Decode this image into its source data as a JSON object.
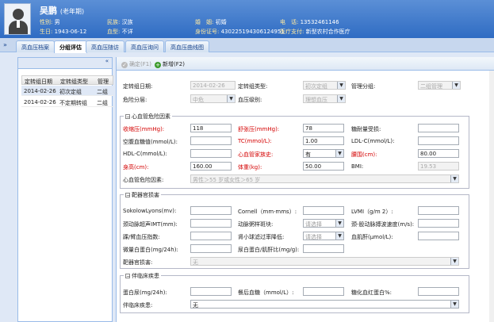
{
  "header": {
    "name": "吴鹏",
    "tag": "(老年期)",
    "gender_label": "性别:",
    "gender": "男",
    "ethnicity_label": "民族:",
    "ethnicity": "汉族",
    "marital_label": "婚　姻:",
    "marital": "初婚",
    "phone_label": "电　话:",
    "phone": "13532461146",
    "birth_label": "生日:",
    "birth": "1943-06-12",
    "blood_label": "血型:",
    "blood": "不详",
    "id_label": "身份证号:",
    "id": "430225194306124951",
    "insurance_label": "医疗支付:",
    "insurance": "新型农村合作医疗"
  },
  "tabs": [
    "高血压档案",
    "分组评估",
    "高血压随访",
    "高血压询问",
    "高血压曲线图"
  ],
  "active_tab": 1,
  "left_panel": {
    "collapse": "«",
    "columns": [
      "定转组日期",
      "定转组类型",
      "管理"
    ],
    "rows": [
      {
        "date": "2014-02-26",
        "type": "初次定组",
        "level": "二组"
      },
      {
        "date": "2014-02-26",
        "type": "不定期转组",
        "level": "二组"
      }
    ]
  },
  "toolbar": {
    "confirm": "确定(F1)",
    "new": "新增(F2)"
  },
  "top_form": {
    "date_label": "定转组日期:",
    "date": "2014-02-26",
    "type_label": "定转组类型:",
    "type": "初次定组",
    "mgmt_label": "管理分组:",
    "mgmt": "二组管理",
    "risk_label": "危险分层:",
    "risk": "中危",
    "bp_label": "血压级别:",
    "bp": "理想血压"
  },
  "section1": {
    "title": "心血管危险因素",
    "sbp_label": "收缩压(mmHg):",
    "sbp": "118",
    "dbp_label": "舒张压(mmHg):",
    "dbp": "78",
    "glucose_tol_label": "糖耐量受损:",
    "glucose_tol": "",
    "fpg_label": "空腹血糖值(mmol/L):",
    "fpg": "",
    "tc_label": "TC(mmol/L):",
    "tc": "1.00",
    "ldl_label": "LDL-C(mmol/L):",
    "ldl": "",
    "hdl_label": "HDL-C(mmol/L):",
    "hdl": "",
    "family_label": "心血管家族史:",
    "family": "有",
    "waist_label": "腰围(cm):",
    "waist": "80.00",
    "height_label": "身高(cm):",
    "height": "160.00",
    "weight_label": "体重(kg):",
    "weight": "50.00",
    "bmi_label": "BMI:",
    "bmi": "19.53",
    "risk_factors_label": "心血管危险因素:",
    "risk_factors": "男性＞55 岁或女性＞65 岁"
  },
  "section2": {
    "title": "靶器官损害",
    "sokolow_label": "SokolowLyons(mv):",
    "sokolow": "",
    "cornell_label": "Cornell（mm·mms）:",
    "cornell": "",
    "lvmi_label": "LVMI（g/m 2）:",
    "lvmi": "",
    "imt_label": "颈动脉超声IMT(mm):",
    "imt": "",
    "plaque_label": "动脉粥样斑块:",
    "plaque": "请选择",
    "pwv_label": "颈-股动脉搏波速度(m/s):",
    "pwv": "",
    "abi_label": "踝/臂血压指数:",
    "abi": "",
    "egfr_label": "肾小球滤过率降低:",
    "egfr": "请选择",
    "creat_label": "血肌酐(μmol/L):",
    "creat": "",
    "malb_label": "微量白蛋白(mg/24h):",
    "malb": "",
    "acr_label": "尿白蛋白/肌酐比(mg/g):",
    "acr": "",
    "damage_label": "靶器官损害:",
    "damage": "无"
  },
  "section3": {
    "title": "伴临床疾患",
    "prot_label": "蛋白尿(mg/24h):",
    "prot": "",
    "ppg_label": "餐后血糖（mmol/L）:",
    "ppg": "",
    "hba1c_label": "糖化血红蛋白%:",
    "hba1c": "",
    "disease_label": "伴临床疾患:",
    "disease": "无"
  }
}
